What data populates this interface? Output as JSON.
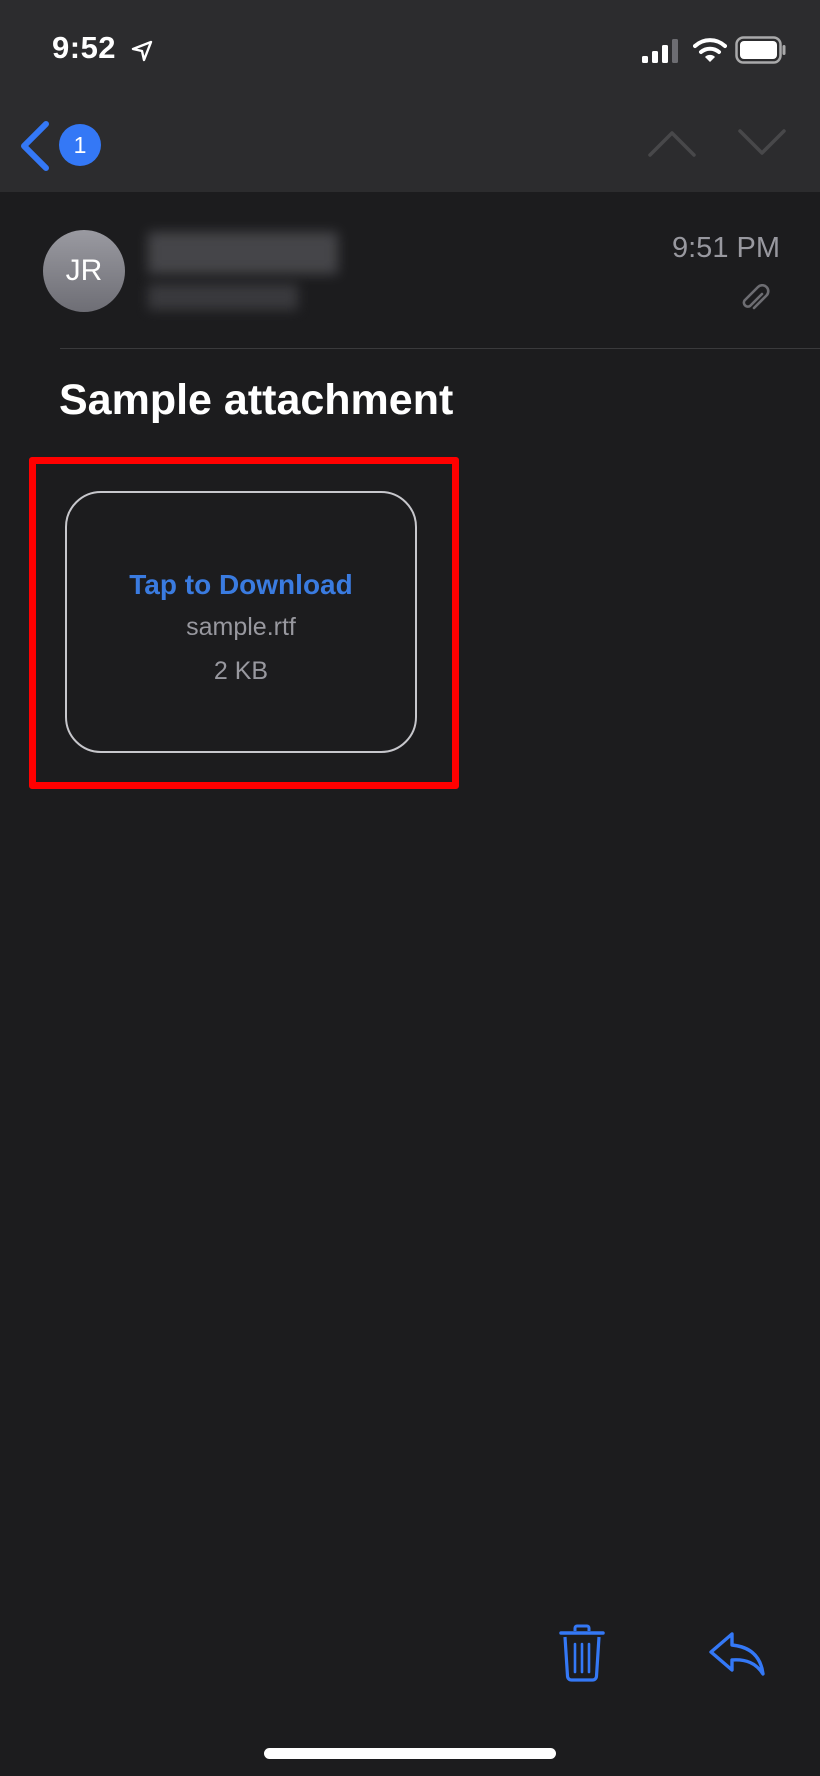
{
  "status_bar": {
    "time": "9:52",
    "icons": [
      "location-arrow-icon",
      "cellular-signal-icon",
      "wifi-icon",
      "battery-icon"
    ]
  },
  "nav_bar": {
    "back_icon": "chevron-left-icon",
    "unread_count": "1",
    "prev_icon": "chevron-up-icon",
    "next_icon": "chevron-down-icon"
  },
  "message": {
    "avatar_initials": "JR",
    "time": "9:51 PM",
    "attachment_indicator_icon": "paperclip-icon",
    "subject": "Sample attachment"
  },
  "attachment": {
    "action_label": "Tap to Download",
    "filename": "sample.rtf",
    "size": "2 KB"
  },
  "toolbar": {
    "trash_icon": "trash-icon",
    "reply_icon": "reply-icon"
  },
  "colors": {
    "background": "#1c1c1e",
    "header_background": "#2c2c2e",
    "accent": "#3478f6",
    "highlight": "#ff0000",
    "secondary_text": "#98989f"
  }
}
